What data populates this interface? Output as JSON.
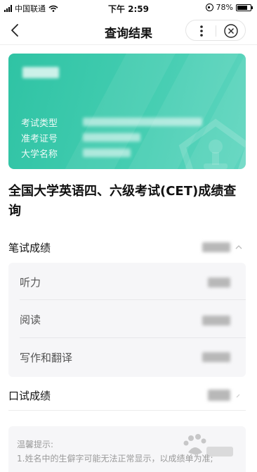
{
  "status_bar": {
    "carrier": "中国联通",
    "time": "下午 2:59",
    "battery": "78%",
    "battery_level": 0.78
  },
  "nav": {
    "title": "查询结果",
    "icons": [
      "back-icon",
      "more-icon",
      "close-icon"
    ]
  },
  "card": {
    "fields": [
      {
        "label": "考试类型"
      },
      {
        "label": "准考证号"
      },
      {
        "label": "大学名称"
      }
    ]
  },
  "page_title": "全国大学英语四、六级考试(CET)成绩查询",
  "written": {
    "label": "笔试成绩",
    "items": [
      {
        "label": "听力"
      },
      {
        "label": "阅读"
      },
      {
        "label": "写作和翻译"
      }
    ]
  },
  "oral": {
    "label": "口试成绩"
  },
  "tips": {
    "title": "温馨提示:",
    "line1": "1.姓名中的生僻字可能无法正常显示，以成绩单为准;"
  },
  "colors": {
    "card_start": "#2fc3a4",
    "card_end": "#5fd5bf",
    "panel_bg": "#f6f6f8"
  }
}
